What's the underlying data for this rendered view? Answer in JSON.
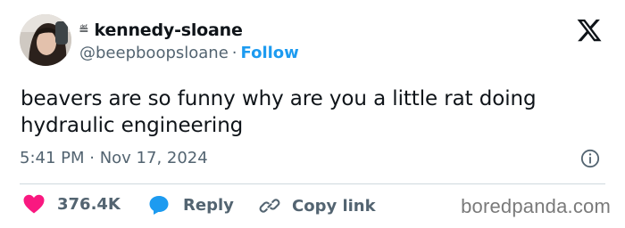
{
  "user": {
    "display_name": "kennedy-sloane",
    "handle": "@beepboopsloane",
    "separator": "·",
    "follow_label": "Follow",
    "badge_icon": "flag-icon"
  },
  "tweet": {
    "text": "beavers are so funny why are you a little rat doing hydraulic engineering",
    "timestamp": "5:41 PM · Nov 17, 2024"
  },
  "actions": {
    "likes_count": "376.4K",
    "reply_label": "Reply",
    "copy_link_label": "Copy link"
  },
  "watermark": "boredpanda.com",
  "colors": {
    "accent": "#1d9bf0",
    "like": "#f91880",
    "text": "#0f1419",
    "muted": "#536471"
  }
}
